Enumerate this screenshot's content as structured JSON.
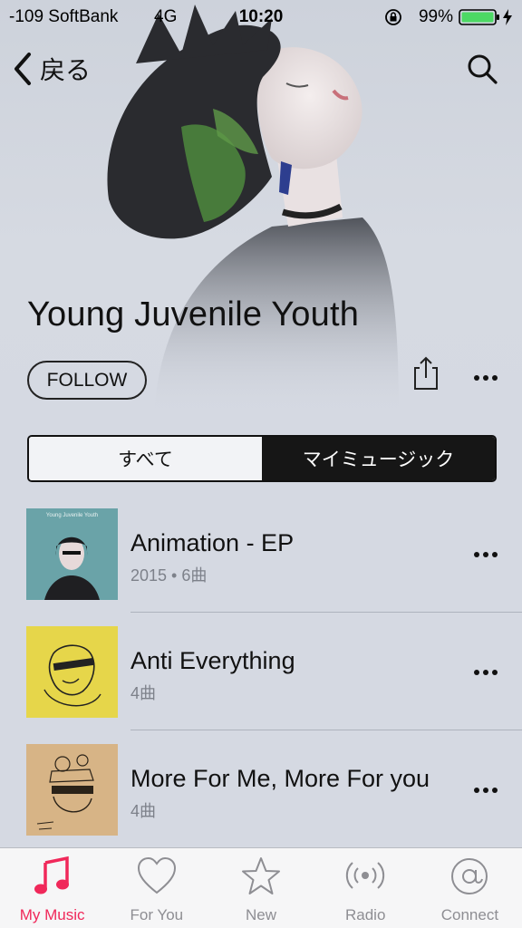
{
  "status_bar": {
    "carrier": "-109 SoftBank",
    "network": "4G",
    "time": "10:20",
    "battery": "99%",
    "icons": [
      "rotation-lock-icon",
      "battery-icon",
      "charging-icon"
    ]
  },
  "nav": {
    "back_label": "戻る",
    "back_icon": "chevron-left-icon",
    "search_icon": "search-icon"
  },
  "artist": {
    "name": "Young Juvenile Youth",
    "follow_label": "FOLLOW",
    "share_icon": "share-icon",
    "more_icon": "more-dots-icon"
  },
  "segments": [
    {
      "label": "すべて",
      "selected": false
    },
    {
      "label": "マイミュージック",
      "selected": true
    }
  ],
  "albums": [
    {
      "title": "Animation - EP",
      "subtitle": "2015 • 6曲",
      "cover_text": "Young Juvenile Youth"
    },
    {
      "title": "Anti Everything",
      "subtitle": "4曲"
    },
    {
      "title": "More For Me, More For you",
      "subtitle": "4曲"
    }
  ],
  "tab_bar": {
    "tabs": [
      {
        "label": "My Music",
        "icon": "music-note-icon",
        "active": true
      },
      {
        "label": "For You",
        "icon": "heart-icon",
        "active": false
      },
      {
        "label": "New",
        "icon": "star-icon",
        "active": false
      },
      {
        "label": "Radio",
        "icon": "radio-waves-icon",
        "active": false
      },
      {
        "label": "Connect",
        "icon": "at-sign-icon",
        "active": false
      }
    ]
  },
  "colors": {
    "accent": "#f0285a",
    "background": "#d5d9e2",
    "segment_active": "#161616",
    "battery_green": "#4cd964"
  }
}
